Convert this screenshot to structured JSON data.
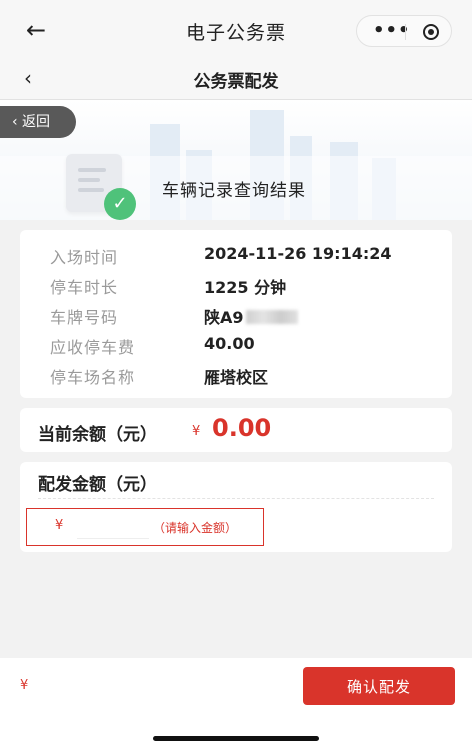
{
  "app_title": "电子公务票",
  "capsule": {
    "more_icon": "more-dots-icon",
    "close_icon": "target-circle-icon"
  },
  "nav": {
    "title": "公务票配发",
    "back_icon": "chevron-left-icon"
  },
  "hero": {
    "title": "车辆记录查询结果",
    "back_label": "‹ 返回"
  },
  "record": [
    {
      "label": "入场时间",
      "value": "2024-11-26 19:14:24"
    },
    {
      "label": "停车时长",
      "value": "1225 分钟"
    },
    {
      "label": "车牌号码",
      "value": "陕A9"
    },
    {
      "label": "应收停车费",
      "value": "40.00"
    },
    {
      "label": "停车场名称",
      "value": "雁塔校区"
    }
  ],
  "balance": {
    "label": "当前余额（元）",
    "currency": "¥",
    "value": "0.00"
  },
  "distribute": {
    "label": "配发金额（元）",
    "currency": "¥",
    "input_value": "",
    "hint": "（请输入金额）"
  },
  "footer": {
    "currency": "¥",
    "confirm_label": "确认配发"
  },
  "colors": {
    "accent": "#d9342b",
    "success": "#4fc27a"
  }
}
